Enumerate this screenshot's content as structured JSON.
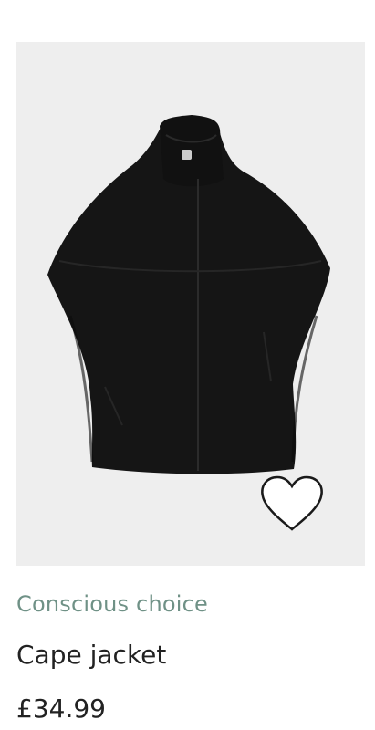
{
  "product": {
    "badge": "Conscious choice",
    "name": "Cape jacket",
    "price": "£34.99",
    "image_alt": "Black cape jacket with high collar",
    "colors": {
      "badge": "#6f9186",
      "text": "#222222",
      "image_background": "#eeeeee",
      "garment": "#151515"
    }
  },
  "actions": {
    "favorite_icon": "heart-outline-icon"
  }
}
